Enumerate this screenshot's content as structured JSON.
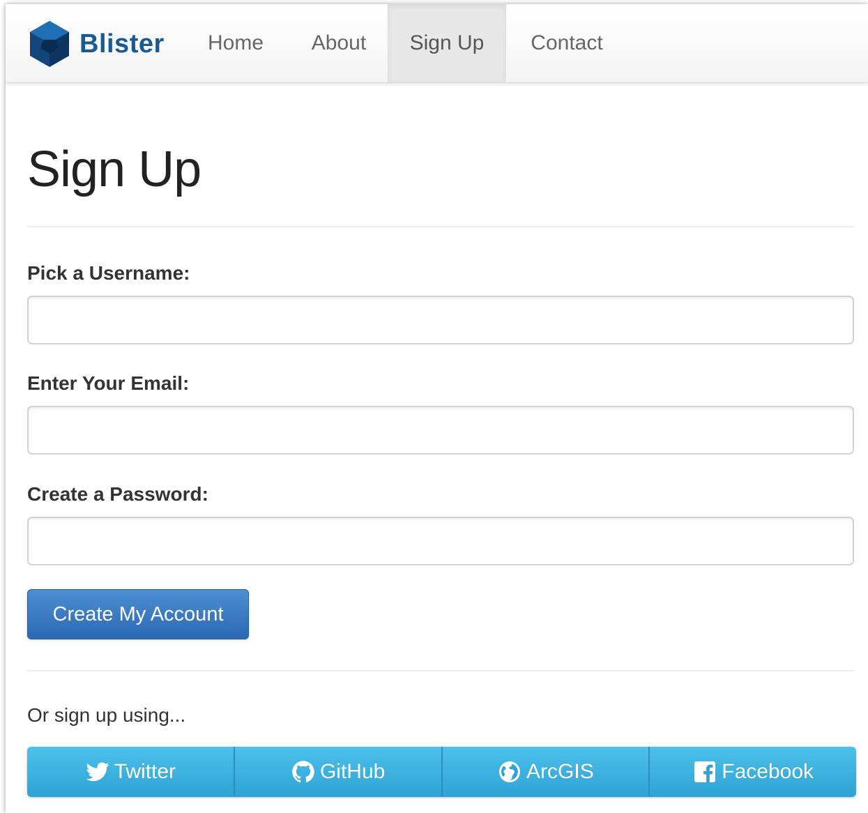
{
  "nav": {
    "brand": "Blister",
    "items": [
      {
        "label": "Home",
        "active": false
      },
      {
        "label": "About",
        "active": false
      },
      {
        "label": "Sign Up",
        "active": true
      },
      {
        "label": "Contact",
        "active": false
      }
    ]
  },
  "page": {
    "title": "Sign Up"
  },
  "form": {
    "username_label": "Pick a Username:",
    "username_value": "",
    "email_label": "Enter Your Email:",
    "email_value": "",
    "password_label": "Create a Password:",
    "password_value": "",
    "submit_label": "Create My Account"
  },
  "social": {
    "prompt": "Or sign up using...",
    "buttons": [
      {
        "label": "Twitter",
        "icon": "twitter-icon"
      },
      {
        "label": "GitHub",
        "icon": "github-icon"
      },
      {
        "label": "ArcGIS",
        "icon": "globe-icon"
      },
      {
        "label": "Facebook",
        "icon": "facebook-icon"
      }
    ]
  },
  "colors": {
    "brand": "#1a5a94",
    "primary_button": "#2c68b4",
    "social_button": "#2ea3d6"
  }
}
